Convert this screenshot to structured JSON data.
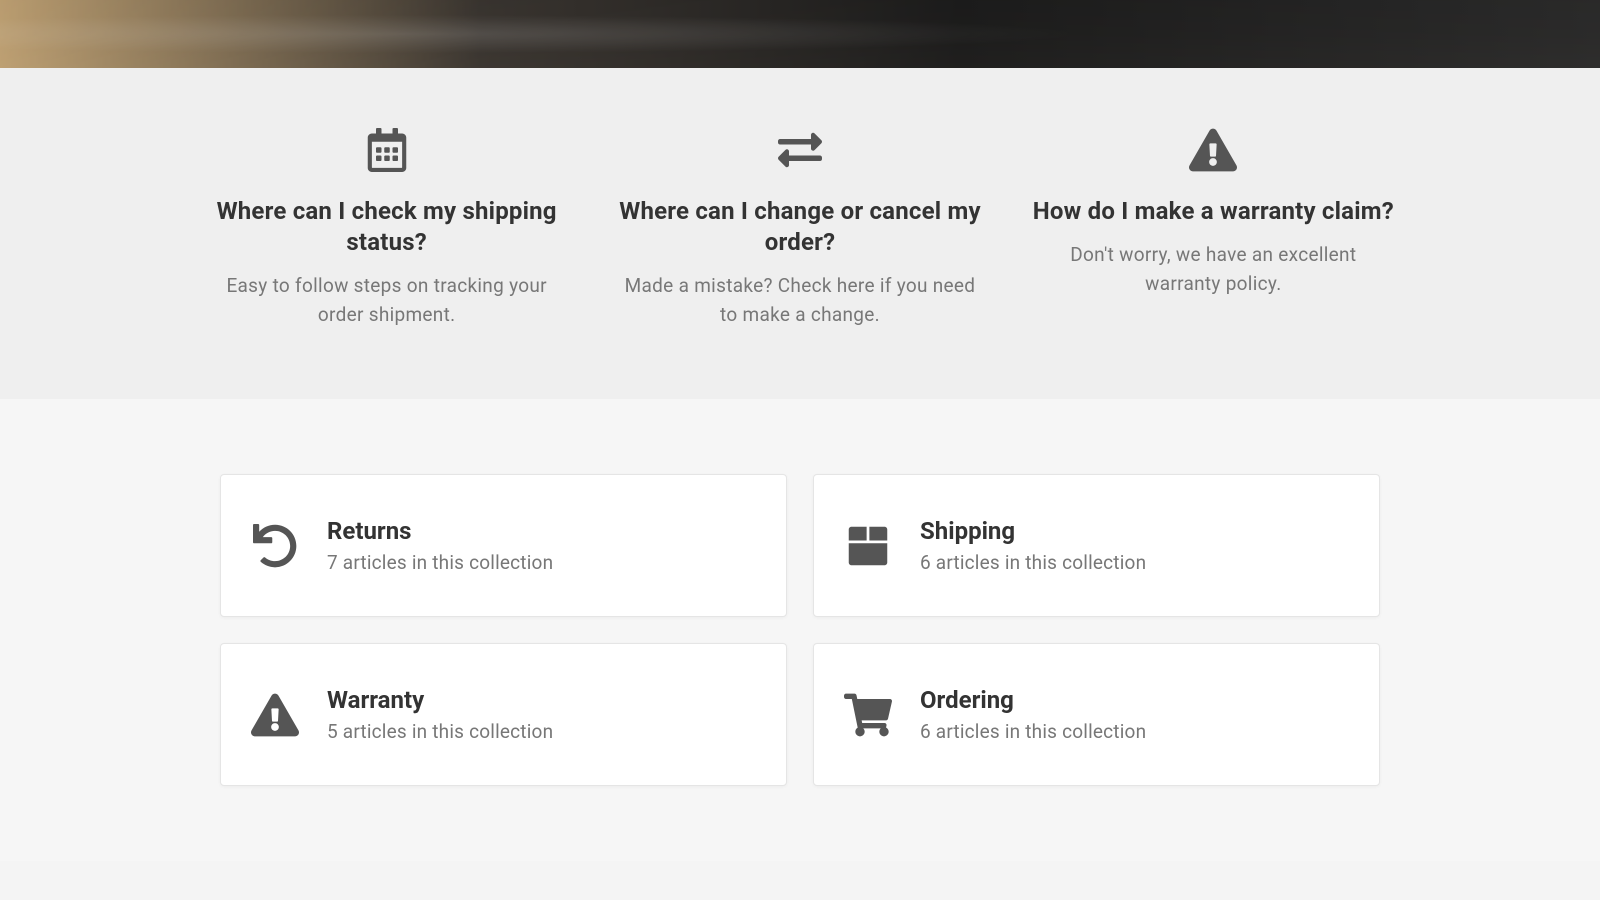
{
  "features": [
    {
      "icon": "calendar-icon",
      "title": "Where can I check my shipping status?",
      "desc": "Easy to follow steps on tracking your order shipment."
    },
    {
      "icon": "exchange-icon",
      "title": "Where can I change or cancel my order?",
      "desc": "Made a mistake? Check here if you need to make a change."
    },
    {
      "icon": "warning-icon",
      "title": "How do I make a warranty claim?",
      "desc": "Don't worry, we have an excellent warranty policy."
    }
  ],
  "collections": [
    {
      "icon": "undo-icon",
      "title": "Returns",
      "count": "7 articles in this collection"
    },
    {
      "icon": "box-icon",
      "title": "Shipping",
      "count": "6 articles in this collection"
    },
    {
      "icon": "warning-icon",
      "title": "Warranty",
      "count": "5 articles in this collection"
    },
    {
      "icon": "cart-icon",
      "title": "Ordering",
      "count": "6 articles in this collection"
    }
  ]
}
